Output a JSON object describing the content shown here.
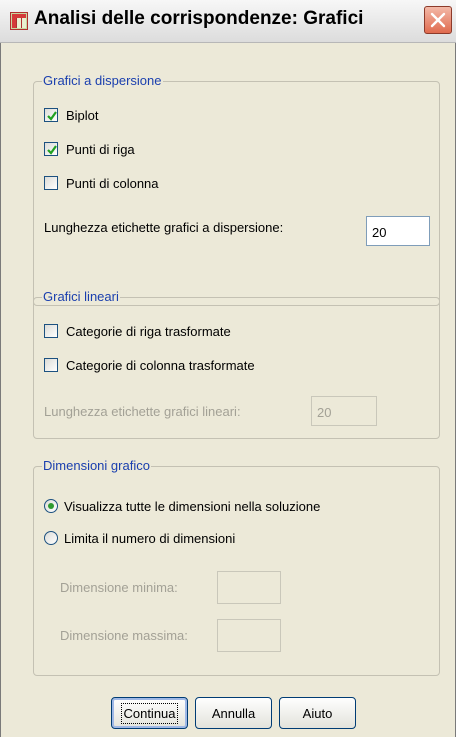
{
  "window": {
    "title": "Analisi delle corrispondenze: Grafici"
  },
  "scatter_group": {
    "legend": "Grafici a dispersione",
    "biplot": {
      "label": "Biplot",
      "checked": true
    },
    "row_points": {
      "label": "Punti di riga",
      "checked": true
    },
    "col_points": {
      "label": "Punti di colonna",
      "checked": false
    },
    "label_length_label": "Lunghezza etichette grafici a dispersione:",
    "label_length_value": "20"
  },
  "line_group": {
    "legend": "Grafici lineari",
    "row_categories": {
      "label": "Categorie di riga trasformate",
      "checked": false
    },
    "col_categories": {
      "label": "Categorie di colonna trasformate",
      "checked": false
    },
    "label_length_label": "Lunghezza etichette grafici lineari:",
    "label_length_value": "20"
  },
  "dimensions_group": {
    "legend": "Dimensioni grafico",
    "show_all": {
      "label": "Visualizza tutte le dimensioni nella soluzione",
      "selected": true
    },
    "restrict": {
      "label": "Limita il numero di dimensioni",
      "selected": false
    },
    "min_label": "Dimensione minima:",
    "min_value": "",
    "max_label": "Dimensione massima:",
    "max_value": ""
  },
  "buttons": {
    "continue": "Continua",
    "cancel": "Annulla",
    "help": "Aiuto"
  },
  "colors": {
    "group_legend": "#1a3fae",
    "disabled_text": "#a3a196",
    "dialog_bg": "#ece9d8"
  }
}
